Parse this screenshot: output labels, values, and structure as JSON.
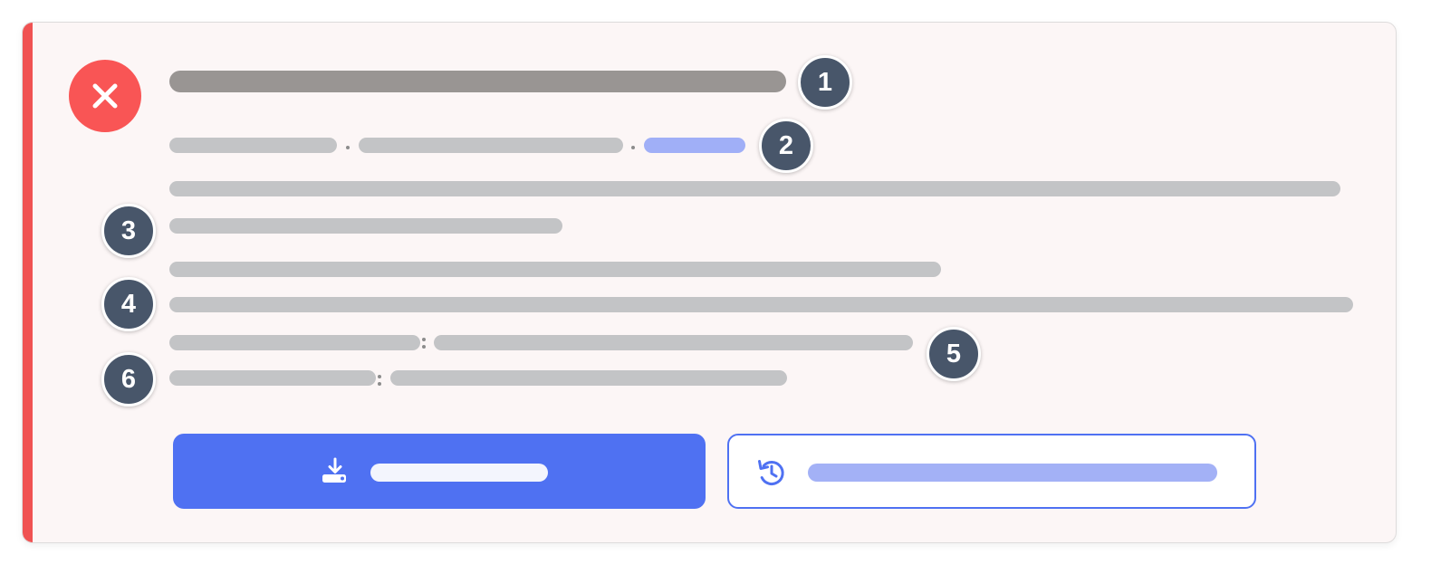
{
  "card": {
    "status": "error",
    "accent_color": "#f05252",
    "status_icon": "close-icon"
  },
  "annotations": [
    "1",
    "2",
    "3",
    "4",
    "5",
    "6"
  ],
  "actions": {
    "primary": {
      "icon": "download-icon",
      "color": "#4f71f2"
    },
    "secondary": {
      "icon": "history-icon",
      "color": "#4f71f2"
    }
  }
}
